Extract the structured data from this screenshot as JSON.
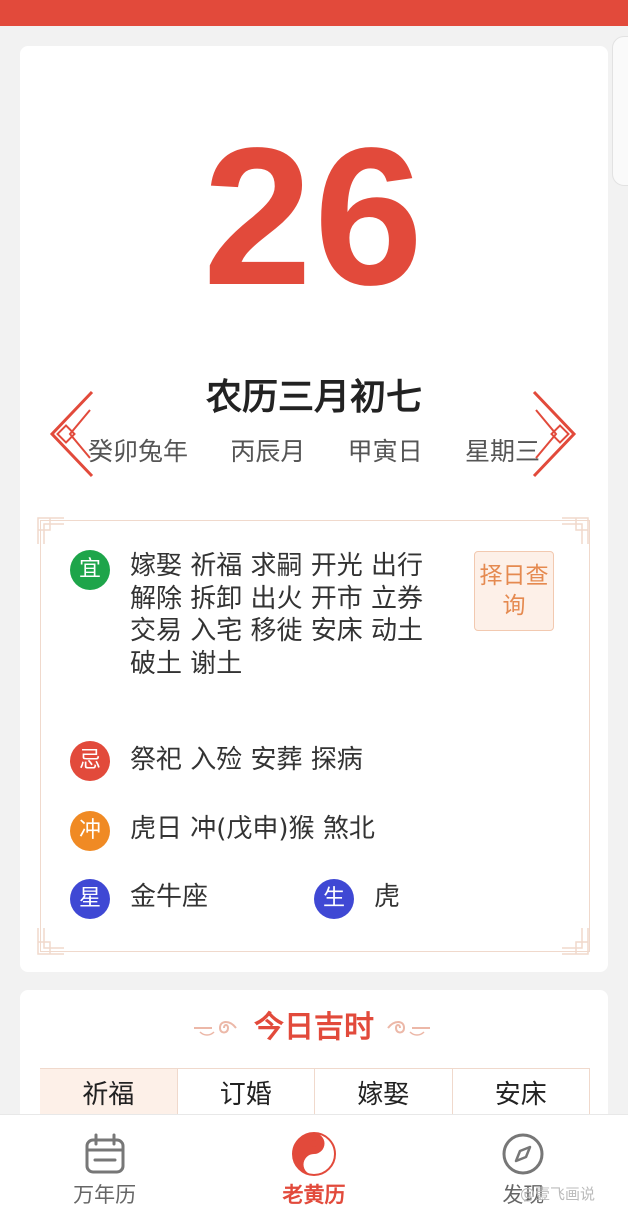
{
  "date": {
    "day": "26",
    "lunar_date": "农历三月初七",
    "ganzhi": [
      "癸卯兔年",
      "丙辰月",
      "甲寅日",
      "星期三"
    ]
  },
  "almanac": {
    "yi_label": "宜",
    "yi_text": "嫁娶  祈福  求嗣  开光  出行  解除  拆卸  出火  开市  立券  交易  入宅  移徙  安床  动土  破土  谢土",
    "pick_day_label": "择日查询",
    "ji_label": "忌",
    "ji_text": "祭祀  入殓  安葬  探病",
    "chong_label": "冲",
    "chong_text": "虎日 冲(戊申)猴  煞北",
    "xing_label": "星",
    "xing_text": "金牛座",
    "sheng_label": "生",
    "sheng_text": "虎"
  },
  "lucky_times": {
    "title": "今日吉时",
    "items": [
      "祈福",
      "订婚",
      "嫁娶",
      "安床"
    ]
  },
  "bottom_nav": {
    "items": [
      {
        "label": "万年历",
        "icon": "calendar-icon"
      },
      {
        "label": "老黄历",
        "icon": "yin-yang-icon"
      },
      {
        "label": "发现",
        "icon": "compass-icon"
      }
    ]
  },
  "colors": {
    "accent_red": "#e24a3b",
    "yi_green": "#1ea54a",
    "chong_orange": "#f08a24",
    "xing_blue": "#3f48d4",
    "pick_day_orange": "#e58a50"
  }
}
